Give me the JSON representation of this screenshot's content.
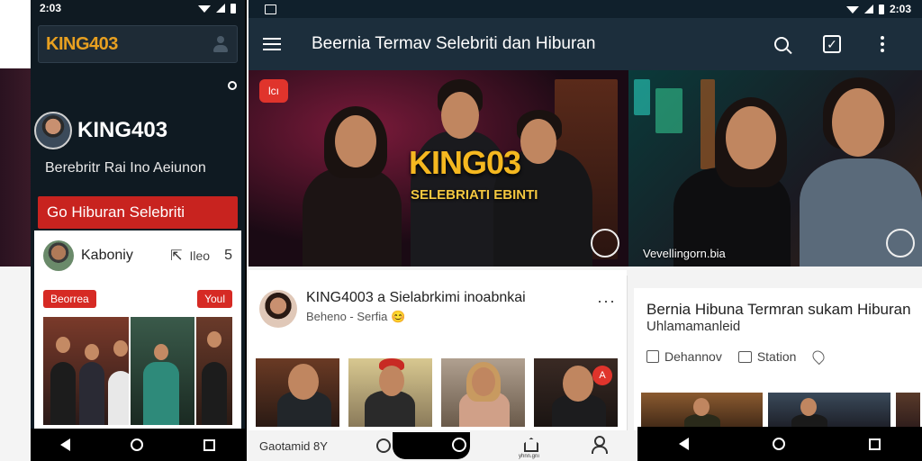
{
  "left_phone": {
    "status_time": "2:03",
    "logo": "KING403",
    "profile_name": "KING403",
    "profile_subtitle": "Berebritr Rai Ino Aeiunon",
    "red_button": "Go Hiburan Selebriti",
    "card": {
      "name": "Kaboniy",
      "meta": "Ileo",
      "more": "5",
      "tag_left": "Beorrea",
      "tag_right": "Youl"
    }
  },
  "main": {
    "status_time": "2:03",
    "app_title": "Beernia Termav Selebriti dan Hiburan",
    "hero": {
      "badge": "lcı",
      "title": "KING03",
      "subtitle": "SELEBRIATI EBINTI",
      "caption_right": "Vevellingorn.bia"
    },
    "post": {
      "name": "KING4003 a Sielabrkimi inoabnkai",
      "meta": "Beheno - Serfia 😊",
      "more": "···"
    },
    "article": {
      "title": "Bernia Hibuna Termran sukam Hiburan",
      "subtitle": "Uhlamamanleid",
      "actions": [
        "Dehannov",
        "Station"
      ]
    },
    "bottom": {
      "label": "Gaotamid 8Y",
      "small_label": "yhnn.gnı"
    }
  },
  "colors": {
    "app_bar": "#1c2e3c",
    "accent_red": "#c8231f",
    "logo_gold": "#f5b820"
  }
}
